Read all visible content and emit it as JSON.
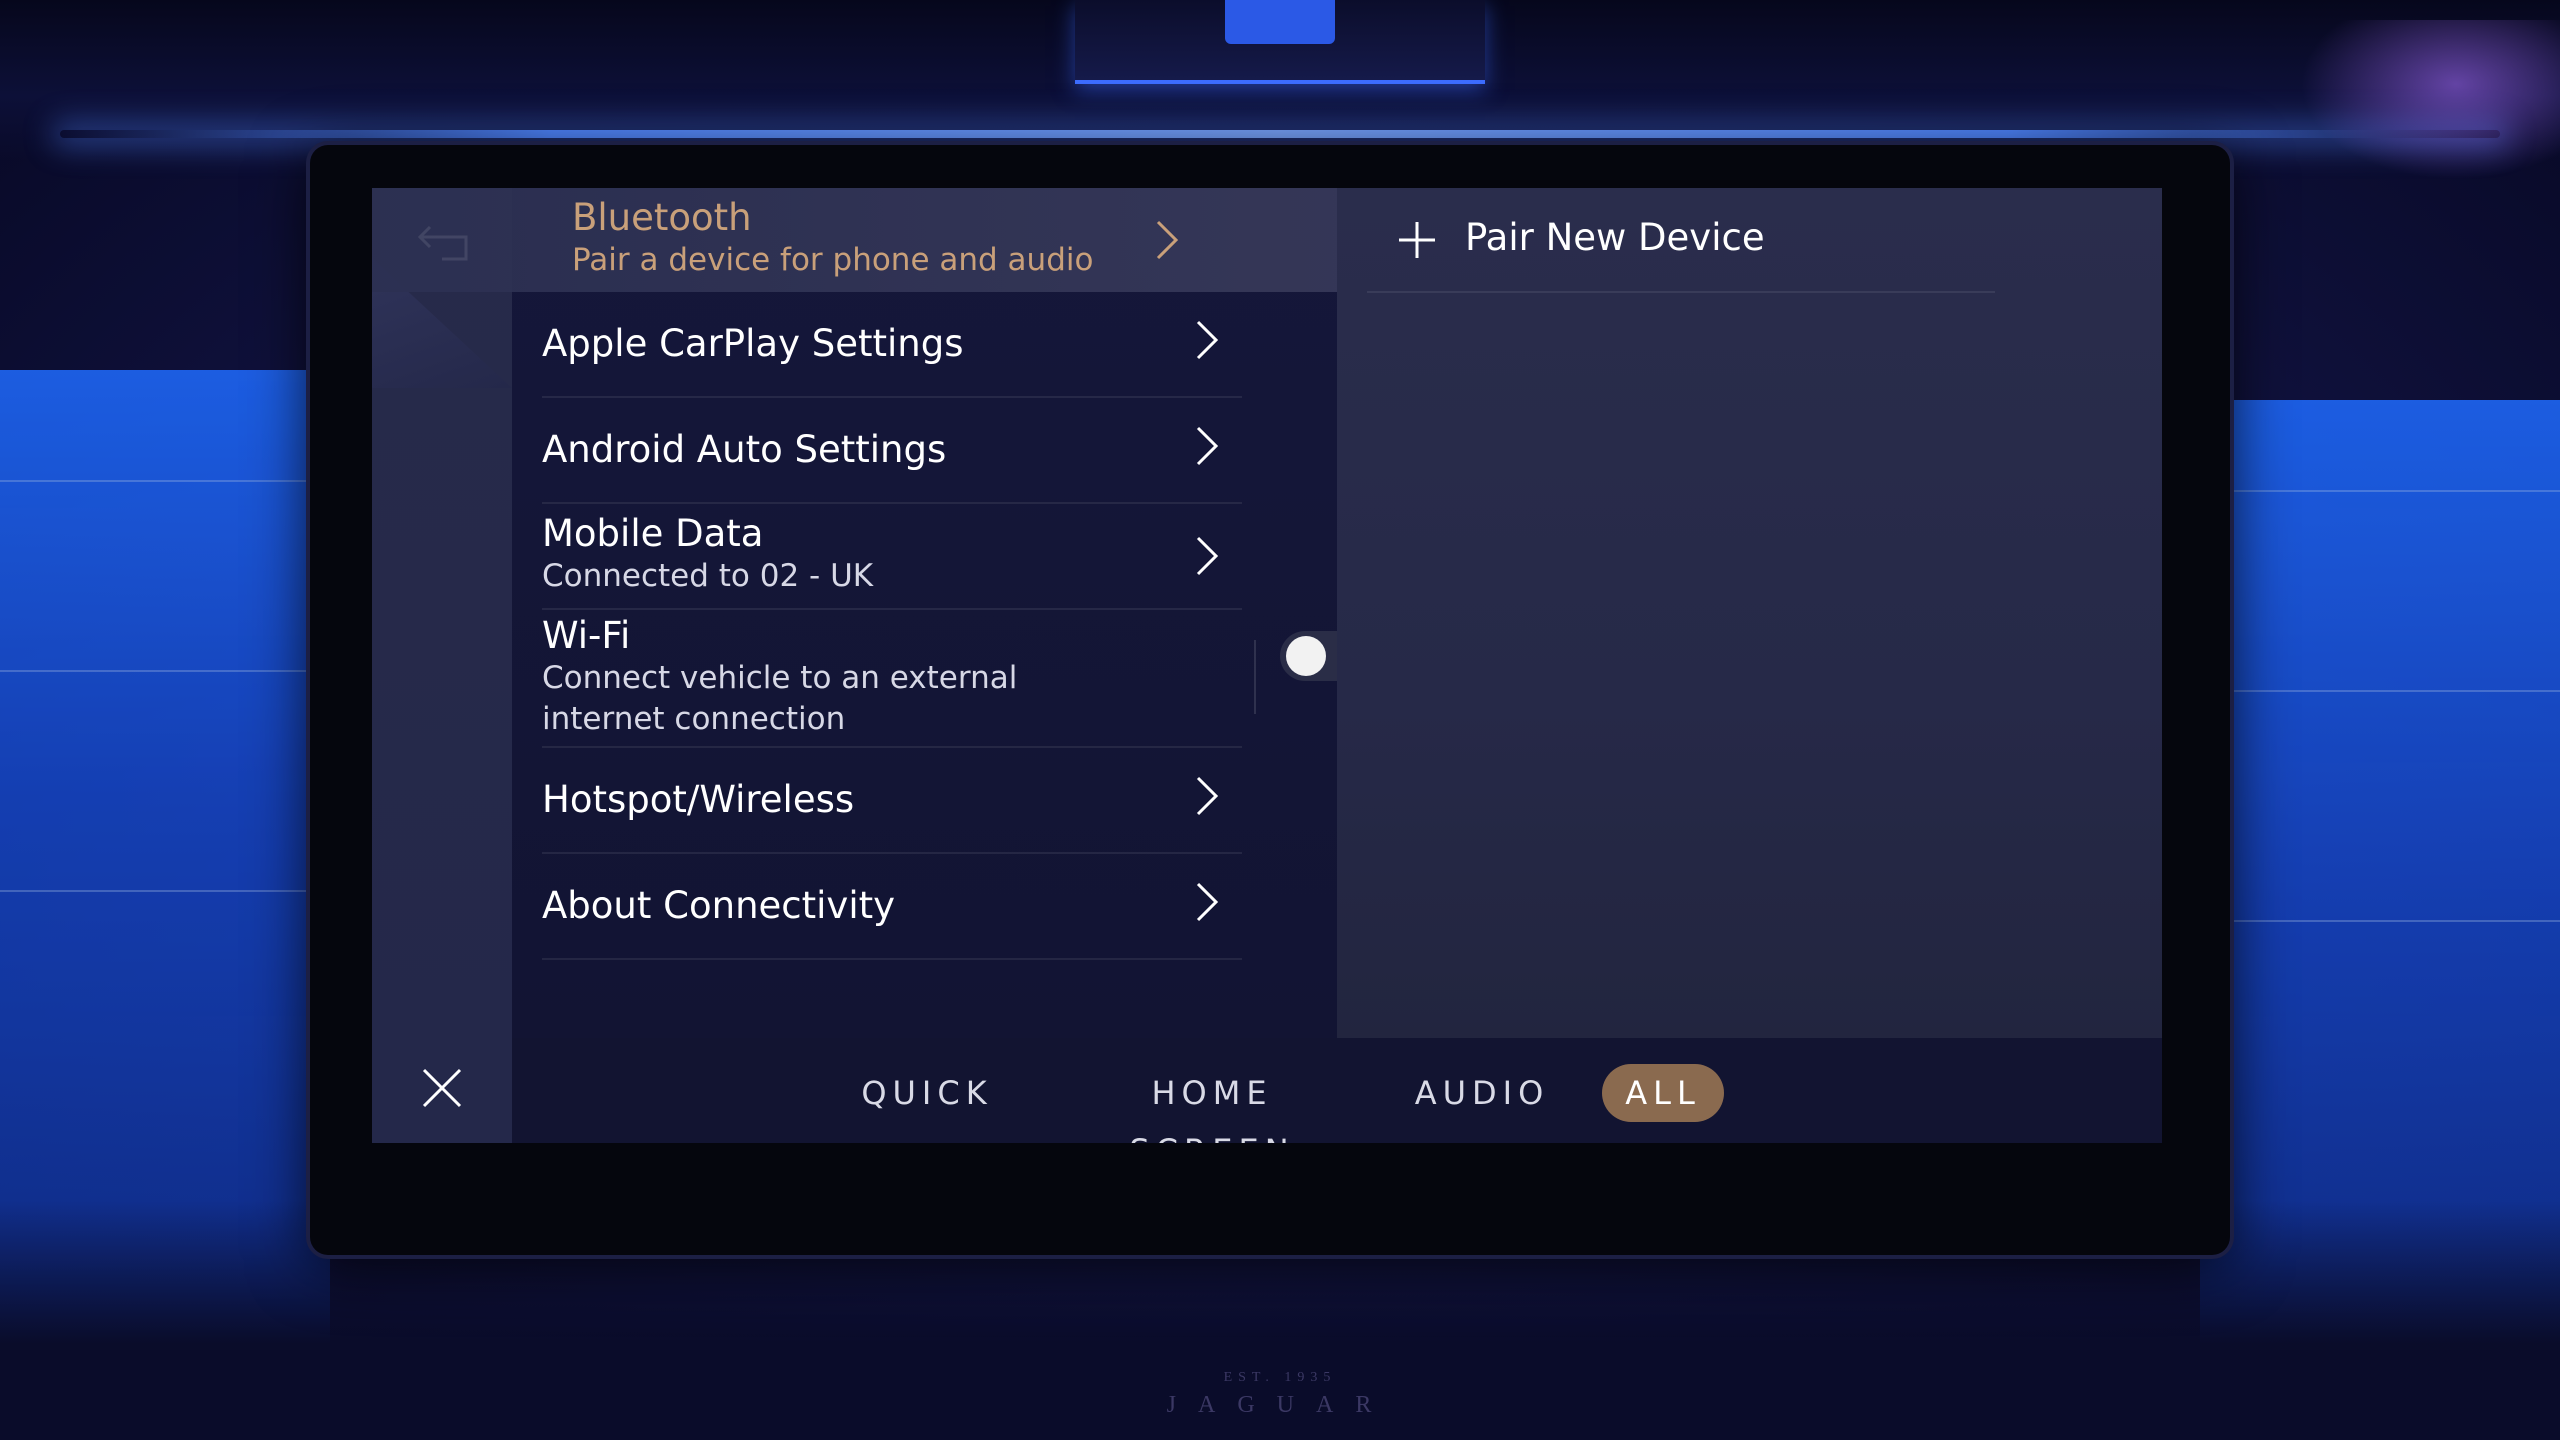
{
  "screen": {
    "back_icon": "back-arrow-icon",
    "close_icon": "close-icon"
  },
  "list": [
    {
      "title": "Bluetooth",
      "subtitle": "Pair a device for phone and audio",
      "active": true
    },
    {
      "title": "Apple CarPlay Settings",
      "subtitle": ""
    },
    {
      "title": "Android Auto Settings",
      "subtitle": ""
    },
    {
      "title": "Mobile Data",
      "subtitle": "Connected to 02 - UK"
    },
    {
      "title": "Wi-Fi",
      "subtitle_line1": "Connect vehicle to an external",
      "subtitle_line2": "internet connection",
      "toggle_on": false
    },
    {
      "title": "Hotspot/Wireless",
      "subtitle": ""
    },
    {
      "title": "About Connectivity",
      "subtitle": ""
    }
  ],
  "detail": {
    "pair_label": "Pair New Device",
    "pair_icon": "plus-icon"
  },
  "tabs": [
    {
      "label": "QUICK"
    },
    {
      "label": "HOME SCREEN"
    },
    {
      "label": "AUDIO"
    },
    {
      "label": "ALL",
      "active": true
    }
  ],
  "brand": {
    "est": "EST. 1935",
    "name": "JAGUAR"
  },
  "colors": {
    "accent": "#c9a07a",
    "active_tab": "#8a6a4f"
  }
}
